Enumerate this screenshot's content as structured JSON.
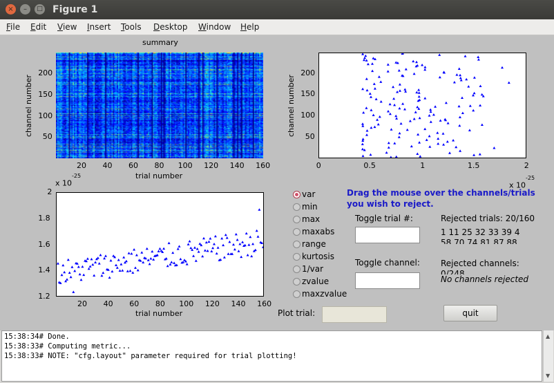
{
  "window": {
    "title": "Figure 1",
    "close_glyph": "×",
    "min_glyph": "–",
    "max_glyph": "□"
  },
  "menu": [
    {
      "label": "File",
      "key": "F",
      "rest": "ile"
    },
    {
      "label": "Edit",
      "key": "E",
      "rest": "dit"
    },
    {
      "label": "View",
      "key": "V",
      "rest": "iew"
    },
    {
      "label": "Insert",
      "key": "I",
      "rest": "nsert"
    },
    {
      "label": "Tools",
      "key": "T",
      "rest": "ools"
    },
    {
      "label": "Desktop",
      "key": "D",
      "rest": "esktop"
    },
    {
      "label": "Window",
      "key": "W",
      "rest": "indow"
    },
    {
      "label": "Help",
      "key": "H",
      "rest": "elp"
    }
  ],
  "chart_data": [
    {
      "type": "heatmap",
      "title": "summary",
      "xlabel": "trial number",
      "ylabel": "channel number",
      "xticks": [
        "20",
        "40",
        "60",
        "80",
        "100",
        "120",
        "140",
        "160"
      ],
      "yticks": [
        "50",
        "100",
        "150",
        "200"
      ],
      "xlim": [
        0.5,
        160.5
      ],
      "ylim": [
        0.5,
        248.5
      ],
      "colormap": [
        "#00008f",
        "#0000ff",
        "#0060ff",
        "#00c0ff",
        "#40ffbf",
        "#ffff00"
      ]
    },
    {
      "type": "scatter",
      "xlabel": "",
      "ylabel": "channel number",
      "xticks": [
        "0",
        "0.5",
        "1",
        "1.5",
        "2"
      ],
      "yticks": [
        "50",
        "100",
        "150",
        "200"
      ],
      "x_exponent": "x 10",
      "x_exponent_power": "-25",
      "xlim": [
        0,
        2
      ],
      "ylim": [
        0,
        248
      ],
      "color": "#0000ff",
      "note": "max per-channel metric values, roughly 0.4–1.9 ×10^-25"
    },
    {
      "type": "scatter",
      "xlabel": "trial number",
      "ylabel": "",
      "xticks": [
        "20",
        "40",
        "60",
        "80",
        "100",
        "120",
        "140",
        "160"
      ],
      "yticks": [
        "1.2",
        "1.4",
        "1.6",
        "1.8",
        "2"
      ],
      "y_exponent": "x 10",
      "y_exponent_power": "-25",
      "xlim": [
        0,
        160
      ],
      "ylim": [
        1.2,
        2.0
      ],
      "color": "#0000ff",
      "trend": {
        "start": 1.38,
        "end": 1.62
      }
    }
  ],
  "metric_options": [
    "var",
    "min",
    "max",
    "maxabs",
    "range",
    "kurtosis",
    "1/var",
    "zvalue",
    "maxzvalue"
  ],
  "selected_metric": "var",
  "instructions": "Drag the mouse over the channels/trials you wish to reject.",
  "instructions_l1": "Drag the mouse over the channels/trials",
  "instructions_l2": "you wish to reject.",
  "toggle_trial_label": "Toggle trial #:",
  "toggle_trial_value": "",
  "toggle_channel_label": "Toggle channel:",
  "toggle_channel_value": "",
  "rejected_trials_label": "Rejected trials: 20/160",
  "rejected_trials_row1": "1   11   25   32   33   39   4",
  "rejected_trials_row2": "58   70   74   81   87   88",
  "rejected_channels_label": "Rejected channels:",
  "rejected_channels_count": "0/248",
  "no_channels_text": "No channels rejected",
  "plot_trial_label": "Plot trial:",
  "plot_trial_value": "",
  "quit_label": "quit",
  "console_lines": [
    "15:38:34# Done.",
    "15:38:33# Computing metric...",
    "15:38:33# NOTE: \"cfg.layout\" parameter required for trial plotting!"
  ]
}
